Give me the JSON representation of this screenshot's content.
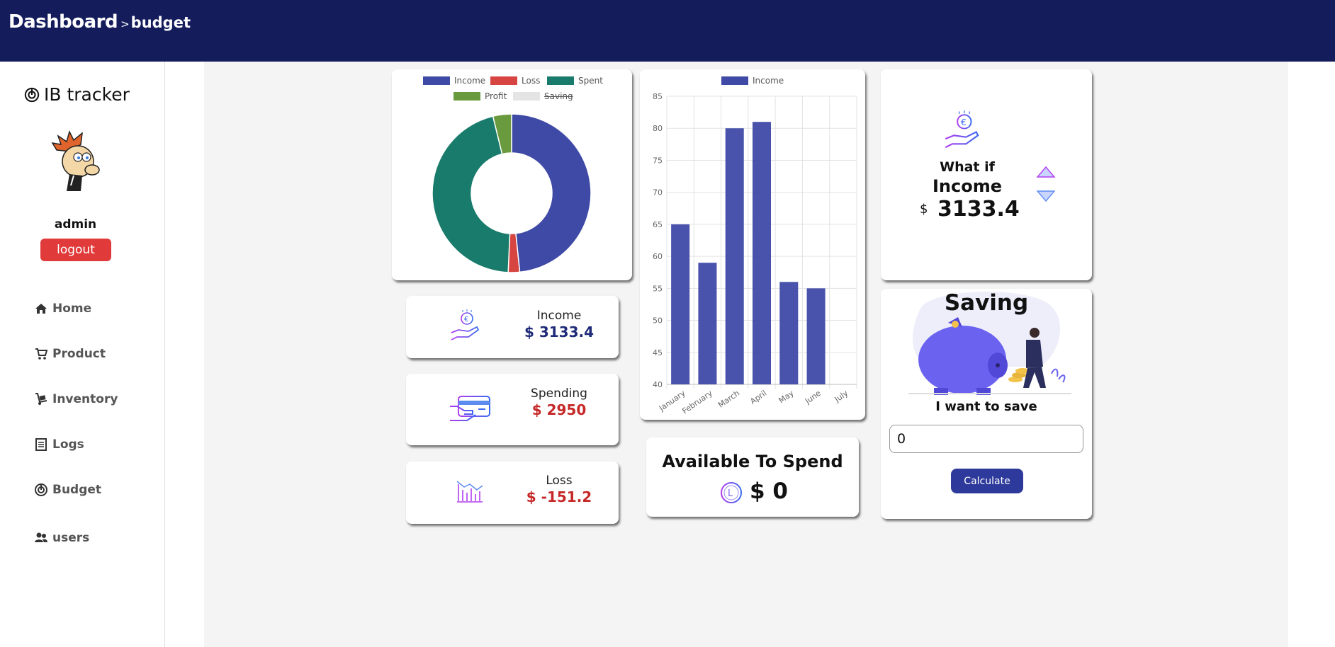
{
  "header": {
    "title": "Dashboard",
    "separator": ">",
    "page": "budget"
  },
  "sidebar": {
    "brand": "IB tracker",
    "username": "admin",
    "logout_label": "logout",
    "items": [
      {
        "label": "Home",
        "icon": "home-icon"
      },
      {
        "label": "Product",
        "icon": "cart-icon"
      },
      {
        "label": "Inventory",
        "icon": "dolly-icon"
      },
      {
        "label": "Logs",
        "icon": "list-icon"
      },
      {
        "label": "Budget",
        "icon": "budget-icon"
      },
      {
        "label": "users",
        "icon": "users-icon"
      }
    ]
  },
  "donut": {
    "legend": [
      {
        "label": "Income",
        "color": "#3f4aa6"
      },
      {
        "label": "Loss",
        "color": "#d64541"
      },
      {
        "label": "Spent",
        "color": "#197b6b"
      },
      {
        "label": "Profit",
        "color": "#6a9a3e"
      },
      {
        "label": "Saving",
        "color": "#e4e4e4",
        "hidden": true
      }
    ]
  },
  "cards": {
    "income": {
      "label": "Income",
      "value": "$ 3133.4",
      "icon": "hand-coin-icon"
    },
    "spending": {
      "label": "Spending",
      "value": "$ 2950",
      "icon": "card-payment-icon"
    },
    "loss": {
      "label": "Loss",
      "value": "$ -151.2",
      "icon": "chart-down-icon"
    }
  },
  "available": {
    "title": "Available To Spend",
    "value": "$ 0",
    "icon": "coin-icon"
  },
  "whatif": {
    "line1": "What if",
    "line2": "Income",
    "currency": "$",
    "value": "3133.4",
    "icon": "hand-coin-icon"
  },
  "saving": {
    "title": "Saving",
    "prompt": "I want to save",
    "input_value": "0",
    "button_label": "Calculate"
  },
  "colors": {
    "navy": "#141c5c",
    "bar": "#3f4aa6",
    "red": "#c62828"
  },
  "chart_data": [
    {
      "type": "pie",
      "title": "",
      "categories": [
        "Income",
        "Loss",
        "Spent",
        "Profit",
        "Saving"
      ],
      "values": [
        3133.4,
        151.2,
        2950,
        245,
        0
      ],
      "legend_placement": "top"
    },
    {
      "type": "bar",
      "title": "",
      "categories": [
        "January",
        "February",
        "March",
        "April",
        "May",
        "June",
        "July"
      ],
      "series": [
        {
          "name": "Income",
          "values": [
            65,
            59,
            80,
            81,
            56,
            55,
            null
          ]
        }
      ],
      "yticks": [
        40,
        45,
        50,
        55,
        60,
        65,
        70,
        75,
        80,
        85
      ],
      "ylim": [
        40,
        85
      ],
      "grid": true,
      "legend_placement": "top"
    }
  ]
}
